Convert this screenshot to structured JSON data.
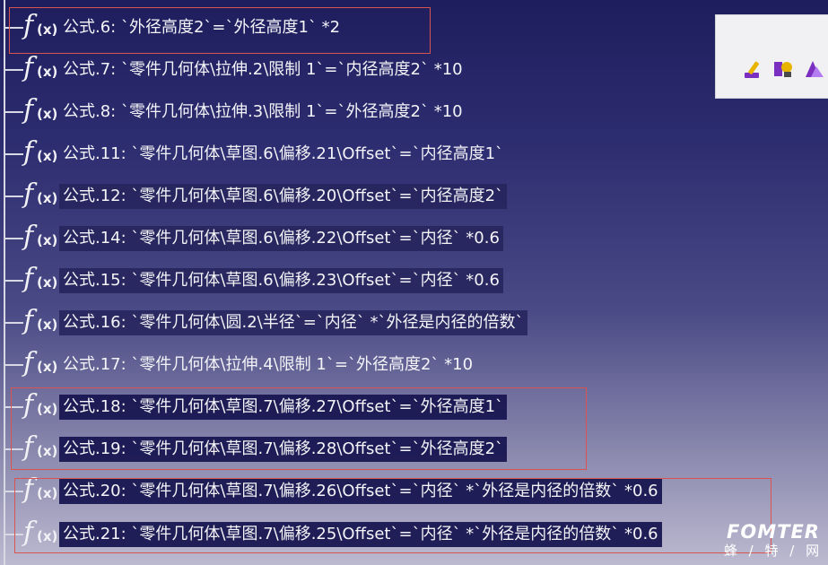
{
  "tree": {
    "icon_f": "f",
    "icon_x": "(x)",
    "formulas": [
      {
        "text": "公式.6: `外径高度2`=`外径高度1` *2"
      },
      {
        "text": "公式.7: `零件几何体\\拉伸.2\\限制 1`=`内径高度2` *10"
      },
      {
        "text": "公式.8: `零件几何体\\拉伸.3\\限制 1`=`外径高度2` *10"
      },
      {
        "text": "公式.11: `零件几何体\\草图.6\\偏移.21\\Offset`=`内径高度1`"
      },
      {
        "text": "公式.12: `零件几何体\\草图.6\\偏移.20\\Offset`=`内径高度2`"
      },
      {
        "text": "公式.14: `零件几何体\\草图.6\\偏移.22\\Offset`=`内径` *0.6"
      },
      {
        "text": "公式.15: `零件几何体\\草图.6\\偏移.23\\Offset`=`内径` *0.6"
      },
      {
        "text": "公式.16: `零件几何体\\圆.2\\半径`=`内径` *`外径是内径的倍数`"
      },
      {
        "text": "公式.17: `零件几何体\\拉伸.4\\限制 1`=`外径高度2` *10"
      },
      {
        "text": "公式.18: `零件几何体\\草图.7\\偏移.27\\Offset`=`外径高度1`"
      },
      {
        "text": "公式.19: `零件几何体\\草图.7\\偏移.28\\Offset`=`外径高度2`"
      },
      {
        "text": "公式.20: `零件几何体\\草图.7\\偏移.26\\Offset`=`内径` *`外径是内径的倍数` *0.6"
      },
      {
        "text": "公式.21: `零件几何体\\草图.7\\偏移.25\\Offset`=`内径` *`外径是内径的倍数` *0.6"
      }
    ]
  },
  "toolbar": {
    "tools": [
      "pencil-edit-icon",
      "formula-tool-icon",
      "sketch-tool-icon"
    ],
    "icon_color": "#7a2fc0"
  },
  "annotation": {
    "box_color": "#d9534f"
  },
  "watermark": {
    "logo": "FOMTER",
    "subtitle": "蜂 / 特 / 网"
  }
}
